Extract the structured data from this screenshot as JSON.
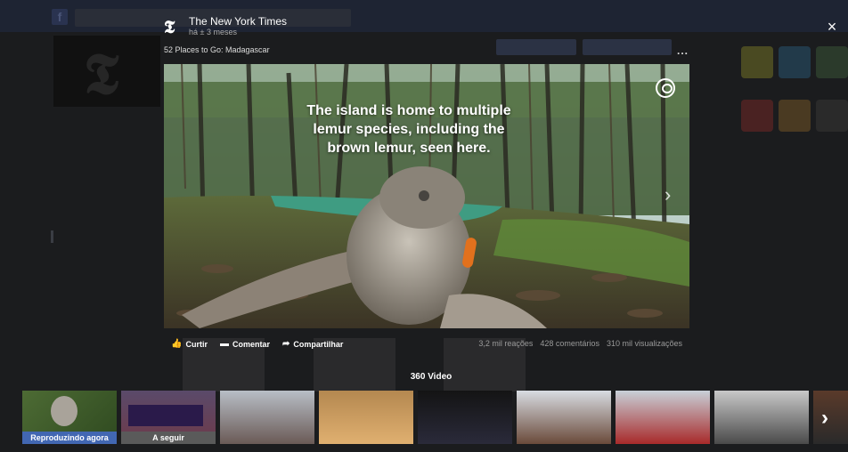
{
  "modal": {
    "publisher": "The New York Times",
    "publisher_logo": "𝕿",
    "timestamp": "há ± 3 meses",
    "video_title": "52 Places to Go: Madagascar",
    "more_label": "...",
    "close_label": "×",
    "caption": "The island is home to multiple lemur species, including the brown lemur, seen here.",
    "actions": [
      {
        "label": "Curtir",
        "icon": "thumbs-up-icon"
      },
      {
        "label": "Comentar",
        "icon": "comment-icon"
      },
      {
        "label": "Compartilhar",
        "icon": "share-icon"
      }
    ],
    "stats": {
      "reactions": "3,2 mil reações",
      "comments": "428 comentários",
      "views": "310 mil visualizações"
    }
  },
  "playlist": {
    "title": "360 Video",
    "now_playing_label": "Reproduzindo agora",
    "up_next_label": "A seguir",
    "next_label": "›"
  },
  "colors": {
    "now_playing": "#4267b2",
    "up_next": "#5a5a5a"
  }
}
